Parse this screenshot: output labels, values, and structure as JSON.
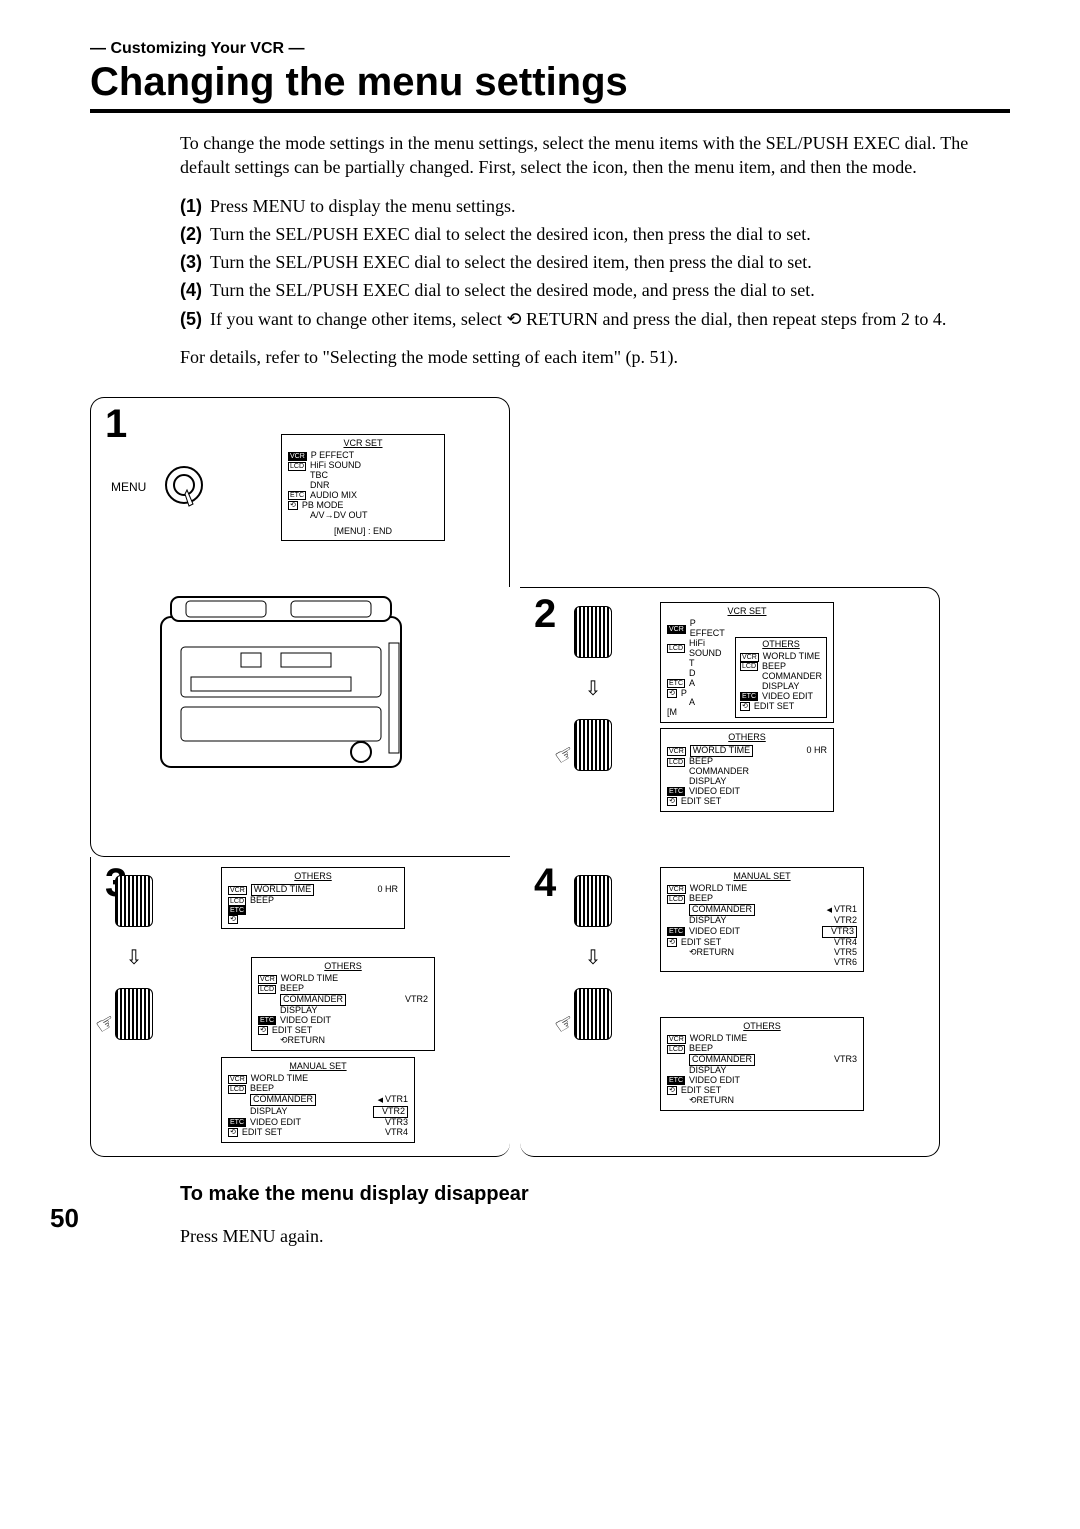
{
  "section_label": "— Customizing Your VCR —",
  "title": "Changing the menu settings",
  "intro": "To change the mode settings in the menu settings, select the menu items with the SEL/PUSH EXEC dial. The default settings can be partially changed. First, select the icon, then the menu item, and then the mode.",
  "steps": [
    "Press MENU to display the menu settings.",
    "Turn the SEL/PUSH EXEC dial to select the desired icon, then press the dial to set.",
    "Turn the SEL/PUSH EXEC dial to select the desired item, then press the dial to set.",
    "Turn the SEL/PUSH EXEC dial to select the desired mode, and press the dial to set.",
    "If you want to change other items, select ⟲ RETURN and press the dial, then repeat steps from 2 to 4."
  ],
  "details_ref": "For details, refer to \"Selecting the mode setting of each item\" (p. 51).",
  "panel1": {
    "menu_label": "MENU",
    "menu": {
      "header": "VCR SET",
      "items": [
        {
          "tag": "VCR",
          "inv": true,
          "label": "P EFFECT"
        },
        {
          "tag": "LCD",
          "label": "HiFi SOUND"
        },
        {
          "tag": "",
          "label": "TBC"
        },
        {
          "tag": "",
          "label": "DNR"
        },
        {
          "tag": "ETC",
          "label": "AUDIO MIX"
        },
        {
          "tag": "⟲",
          "label": "PB MODE"
        },
        {
          "tag": "",
          "label": "A/V→DV OUT"
        }
      ],
      "footer": "[MENU] : END"
    }
  },
  "panel2": {
    "menu_a": {
      "header": "VCR SET",
      "left": [
        {
          "t": "VCR",
          "i": true,
          "l": "P EFFECT"
        },
        {
          "t": "LCD",
          "l": "HiFi SOUND"
        },
        {
          "t": "",
          "l": "T"
        },
        {
          "t": "",
          "l": "D"
        },
        {
          "t": "ETC",
          "l": "A"
        },
        {
          "t": "⟲",
          "l": "P"
        },
        {
          "t": "",
          "l": "A"
        }
      ],
      "right_header": "OTHERS",
      "right": [
        {
          "t": "VCR",
          "l": "WORLD TIME"
        },
        {
          "t": "LCD",
          "l": "BEEP"
        },
        {
          "t": "",
          "l": "COMMANDER"
        },
        {
          "t": "",
          "l": "DISPLAY"
        },
        {
          "t": "ETC",
          "i": true,
          "l": "VIDEO EDIT"
        },
        {
          "t": "⟲",
          "l": "EDIT SET"
        }
      ],
      "footer": "[M"
    },
    "menu_b": {
      "header": "OTHERS",
      "items": [
        {
          "t": "VCR",
          "l": "WORLD TIME",
          "sel": true,
          "val": "0  HR"
        },
        {
          "t": "LCD",
          "l": "BEEP"
        },
        {
          "t": "",
          "l": "COMMANDER"
        },
        {
          "t": "",
          "l": "DISPLAY"
        },
        {
          "t": "ETC",
          "i": true,
          "l": "VIDEO EDIT"
        },
        {
          "t": "⟲",
          "l": "EDIT SET"
        }
      ]
    }
  },
  "panel3": {
    "menu_a": {
      "header": "OTHERS",
      "items": [
        {
          "t": "VCR",
          "l": "WORLD TIME",
          "sel": true,
          "val": "0  HR"
        },
        {
          "t": "LCD",
          "l": "BEEP"
        },
        {
          "t": "",
          "l": ""
        },
        {
          "t": "",
          "l": ""
        },
        {
          "t": "ETC",
          "i": true,
          "l": ""
        },
        {
          "t": "⟲",
          "l": ""
        }
      ]
    },
    "menu_b": {
      "header": "OTHERS",
      "items": [
        {
          "t": "VCR",
          "l": "WORLD TIME"
        },
        {
          "t": "LCD",
          "l": "BEEP"
        },
        {
          "t": "",
          "l": "COMMANDER",
          "sel": true,
          "val": "VTR2"
        },
        {
          "t": "",
          "l": "DISPLAY"
        },
        {
          "t": "ETC",
          "i": true,
          "l": "VIDEO EDIT"
        },
        {
          "t": "⟲",
          "l": "EDIT SET"
        },
        {
          "t": "",
          "l": "⟲RETURN"
        }
      ]
    },
    "menu_c": {
      "header": "MANUAL SET",
      "items": [
        {
          "t": "VCR",
          "l": "WORLD TIME"
        },
        {
          "t": "LCD",
          "l": "BEEP"
        },
        {
          "t": "",
          "l": "COMMANDER",
          "sel": true,
          "tri": true,
          "val": "VTR1"
        },
        {
          "t": "",
          "l": "DISPLAY",
          "val": "VTR2",
          "valSel": true
        },
        {
          "t": "ETC",
          "i": true,
          "l": "VIDEO EDIT",
          "val": "VTR3"
        },
        {
          "t": "⟲",
          "l": "EDIT SET",
          "val": "VTR4"
        }
      ]
    }
  },
  "panel4": {
    "menu_a": {
      "header": "MANUAL SET",
      "items": [
        {
          "t": "VCR",
          "l": "WORLD TIME"
        },
        {
          "t": "LCD",
          "l": "BEEP"
        },
        {
          "t": "",
          "l": "COMMANDER",
          "sel": true,
          "tri": true,
          "val": "VTR1"
        },
        {
          "t": "",
          "l": "DISPLAY",
          "val": "VTR2"
        },
        {
          "t": "ETC",
          "i": true,
          "l": "VIDEO EDIT",
          "val": "VTR3",
          "valSel": true
        },
        {
          "t": "⟲",
          "l": "EDIT SET",
          "val": "VTR4"
        },
        {
          "t": "",
          "l": "⟲RETURN",
          "val": "VTR5"
        },
        {
          "t": "",
          "l": "",
          "val": "VTR6"
        }
      ]
    },
    "menu_b": {
      "header": "OTHERS",
      "items": [
        {
          "t": "VCR",
          "l": "WORLD TIME"
        },
        {
          "t": "LCD",
          "l": "BEEP"
        },
        {
          "t": "",
          "l": "COMMANDER",
          "sel": true,
          "val": "VTR3"
        },
        {
          "t": "",
          "l": "DISPLAY"
        },
        {
          "t": "ETC",
          "i": true,
          "l": "VIDEO EDIT"
        },
        {
          "t": "⟲",
          "l": "EDIT SET"
        },
        {
          "t": "",
          "l": "⟲RETURN"
        }
      ]
    }
  },
  "subhead": "To make the menu display disappear",
  "footer_text": "Press MENU again.",
  "page_number": "50"
}
